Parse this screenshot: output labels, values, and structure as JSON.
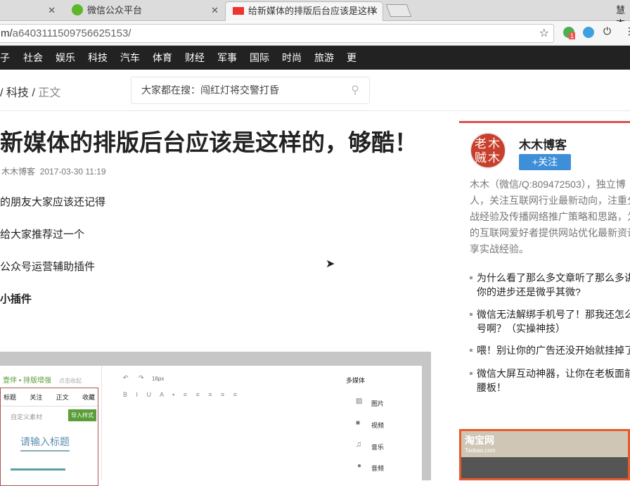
{
  "browser": {
    "tabs": [
      {
        "label": ""
      },
      {
        "label": "微信公众平台"
      },
      {
        "label": "给新媒体的排版后台应该是这样的"
      }
    ],
    "profile": "慧杰",
    "url_host": "m/",
    "url_path": "a6403111509756625153/",
    "ext_badge": "1"
  },
  "nav": [
    "子",
    "社会",
    "娱乐",
    "科技",
    "汽车",
    "体育",
    "财经",
    "军事",
    "国际",
    "时尚",
    "旅游",
    "更多"
  ],
  "breadcrumb": {
    "section": "科技",
    "current": "正文"
  },
  "search": {
    "placeholder": "大家都在搜：闯红灯将交警打昏"
  },
  "article": {
    "title": "新媒体的排版后台应该是这样的，够酷！",
    "author": "木木博客",
    "date": "2017-03-30 11:19",
    "paragraphs": [
      "的朋友大家应该还记得",
      "给大家推荐过一个",
      "公众号运营辅助插件",
      "小插件"
    ]
  },
  "editor": {
    "brand": "壹伴 • 排版增强",
    "collapse": "点击收起",
    "tabs": [
      "标题",
      "关注",
      "正文",
      "收藏"
    ],
    "custom": "自定义素材",
    "import": "导入样式",
    "sample_title": "请输入标题",
    "font_size": "16px",
    "media_title": "多媒体",
    "media": [
      "图片",
      "视频",
      "音乐",
      "音频"
    ]
  },
  "sidebar": {
    "avatar_text": "老木贼木",
    "name": "木木博客",
    "follow": "+关注",
    "bio": [
      "木木（微信/Q:809472503），独立博",
      "人，关注互联网行业最新动向，注重分",
      "战经验及传播网络推广策略和思路，为",
      "的互联网爱好者提供网站优化最新资讯",
      "享实战经验。"
    ],
    "related": [
      [
        "为什么看了那么多文章听了那么多讲",
        "你的进步还是微乎其微?"
      ],
      [
        "微信无法解绑手机号了！那我还怎么",
        "号啊？（实操神技）"
      ],
      [
        "喂！别让你的广告还没开始就挂掉了"
      ],
      [
        "微信大屏互动神器，让你在老板面前",
        "腰板！"
      ]
    ],
    "ad": {
      "logo": "淘宝网",
      "sub": "Taobao.com"
    }
  },
  "colors": {
    "accent": "#d9534f",
    "follow": "#3e8fd8",
    "nav": "#222222"
  }
}
